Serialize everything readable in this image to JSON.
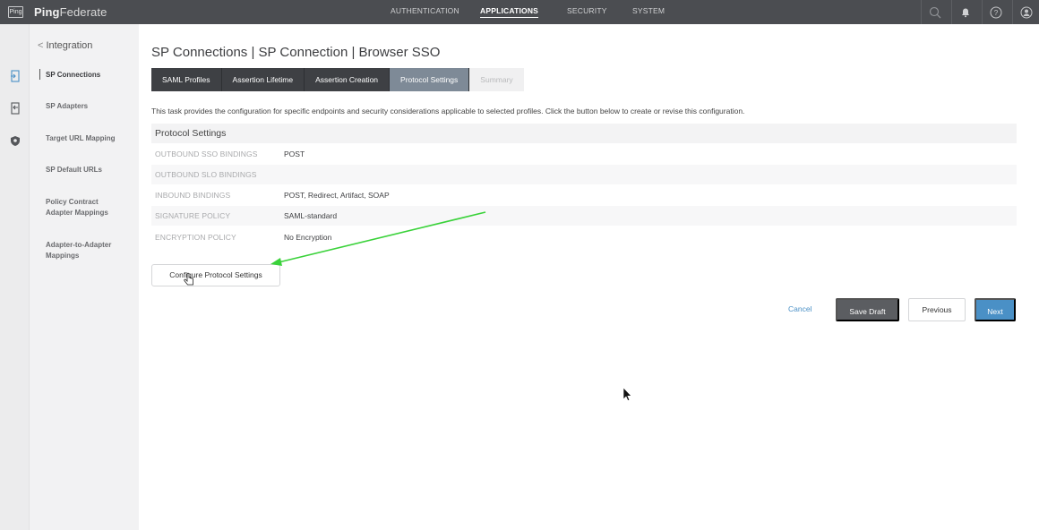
{
  "topbar": {
    "logo_text": "Ping",
    "brand_bold": "Ping",
    "brand_light": "Federate",
    "nav": [
      "AUTHENTICATION",
      "APPLICATIONS",
      "SECURITY",
      "SYSTEM"
    ],
    "active_nav": "APPLICATIONS",
    "icons": [
      "search-icon",
      "bell-icon",
      "help-icon",
      "user-icon"
    ]
  },
  "rail": {
    "icons": [
      "connections-icon",
      "adapters-icon",
      "shield-icon"
    ]
  },
  "subnav": {
    "back_label": "Integration",
    "items": [
      "SP Connections",
      "SP Adapters",
      "Target URL Mapping",
      "SP Default URLs",
      "Policy Contract Adapter Mappings",
      "Adapter-to-Adapter Mappings"
    ],
    "active_item": "SP Connections"
  },
  "main": {
    "title": "SP Connections | SP Connection | Browser SSO",
    "tabs": [
      "SAML Profiles",
      "Assertion Lifetime",
      "Assertion Creation",
      "Protocol Settings",
      "Summary"
    ],
    "current_tab": "Protocol Settings",
    "disabled_tab": "Summary",
    "description": "This task provides the configuration for specific endpoints and security considerations applicable to selected profiles. Click the button below to create or revise this configuration.",
    "section_title": "Protocol Settings",
    "rows": [
      {
        "key": "OUTBOUND SSO BINDINGS",
        "value": "POST"
      },
      {
        "key": "OUTBOUND SLO BINDINGS",
        "value": ""
      },
      {
        "key": "INBOUND BINDINGS",
        "value": "POST, Redirect, Artifact, SOAP"
      },
      {
        "key": "SIGNATURE POLICY",
        "value": "SAML-standard"
      },
      {
        "key": "ENCRYPTION POLICY",
        "value": "No Encryption"
      }
    ],
    "configure_button": "Configure Protocol Settings",
    "cancel_label": "Cancel",
    "save_draft_label": "Save Draft",
    "previous_label": "Previous",
    "next_label": "Next"
  },
  "colors": {
    "topbar": "#4b4d51",
    "tab_dark": "#3e4044",
    "tab_current": "#7e8a97",
    "accent_blue": "#4a90c6",
    "annotation_arrow": "#3ad23a"
  }
}
